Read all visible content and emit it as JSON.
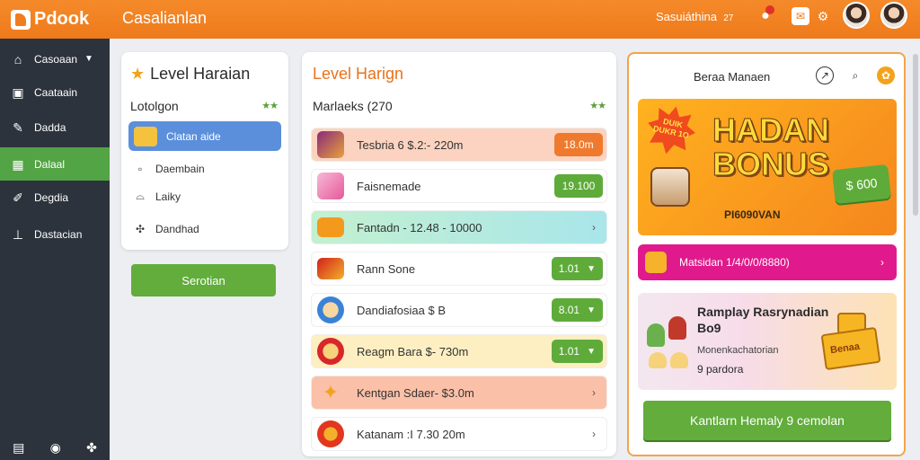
{
  "header": {
    "logo_text": "Pdook",
    "app_title": "Casalianlan",
    "user_name": "Sasuiáthina",
    "user_count": "27",
    "icons": [
      "notification-icon",
      "mail-icon",
      "settings-icon"
    ]
  },
  "sidebar": {
    "items": [
      {
        "label": "Casoaan",
        "icon": "home-icon"
      },
      {
        "label": "Caataain",
        "icon": "profile-icon"
      },
      {
        "label": "Dadda",
        "icon": "pencil-icon"
      },
      {
        "label": "Dalaal",
        "icon": "grid-icon"
      },
      {
        "label": "Degdia",
        "icon": "wrench-icon"
      },
      {
        "label": "Dastacian",
        "icon": "user-icon"
      }
    ],
    "bottom_icons": [
      "stack-icon",
      "globe-icon",
      "share-icon"
    ]
  },
  "panel1": {
    "title": "Level Haraian",
    "subtitle": "Lotolgon",
    "rating": "★★",
    "selected": "Clatan aide",
    "items": [
      "Daembain",
      "Laiky",
      "Dandhad"
    ],
    "button": "Serotian"
  },
  "panel2": {
    "title": "Level Harign",
    "subtitle": "Marlaeks (270",
    "rating": "★★",
    "rows": [
      {
        "label": "Tesbria 6 $.2:- 220m",
        "value": "18.0m",
        "style": "pill-orange",
        "bg": "#fbd3c0"
      },
      {
        "label": "Faisnemade",
        "value": "19.100",
        "style": "pill-green",
        "bg": "#ffffff"
      },
      {
        "label": "Fantadn - 12.48 - 10000",
        "value": "",
        "style": "arrow",
        "bg": "#a9e6ea"
      },
      {
        "label": "Rann Sone",
        "value": "1.01",
        "style": "pill-green-chev",
        "bg": "#ffffff"
      },
      {
        "label": "Dandiafosiaa $ B",
        "value": "8.01",
        "style": "pill-green-chev",
        "bg": "#ffffff"
      },
      {
        "label": "Reagm Bara $- 730m",
        "value": "1.01",
        "style": "pill-green-chev",
        "bg": "#fdefc2"
      },
      {
        "label": "Kentgan Sdaer- $3.0m",
        "value": "",
        "style": "arrow",
        "bg": "#fbc0a8"
      },
      {
        "label": "Katanam :I 7.30 20m",
        "value": "",
        "style": "arrow",
        "bg": "#ffffff"
      }
    ]
  },
  "panel3": {
    "heading": "Beraa Manaen",
    "banner": {
      "burst_text": "DUIK DUKR 1O",
      "title_line1": "HADAN",
      "title_line2": "BONUS",
      "coin_value": "$ 600",
      "subtitle": "PI6090VAN"
    },
    "promo_row": "Matsidan 1/4/0/0/8880)",
    "card": {
      "title": "Ramplay Rasrynadian Bo9",
      "sub": "Monenkachatorian",
      "sub2": "9 pardora",
      "chest_label": "Benaa"
    },
    "cta": "Kantlarn Hemaly 9 cemolan"
  },
  "colors": {
    "brand_orange": "#ee7a1b",
    "sidebar_dark": "#2d333c",
    "active_green": "#53a444",
    "button_green": "#62ad3c",
    "selected_blue": "#5b8fdc",
    "promo_magenta": "#e01a8c"
  }
}
